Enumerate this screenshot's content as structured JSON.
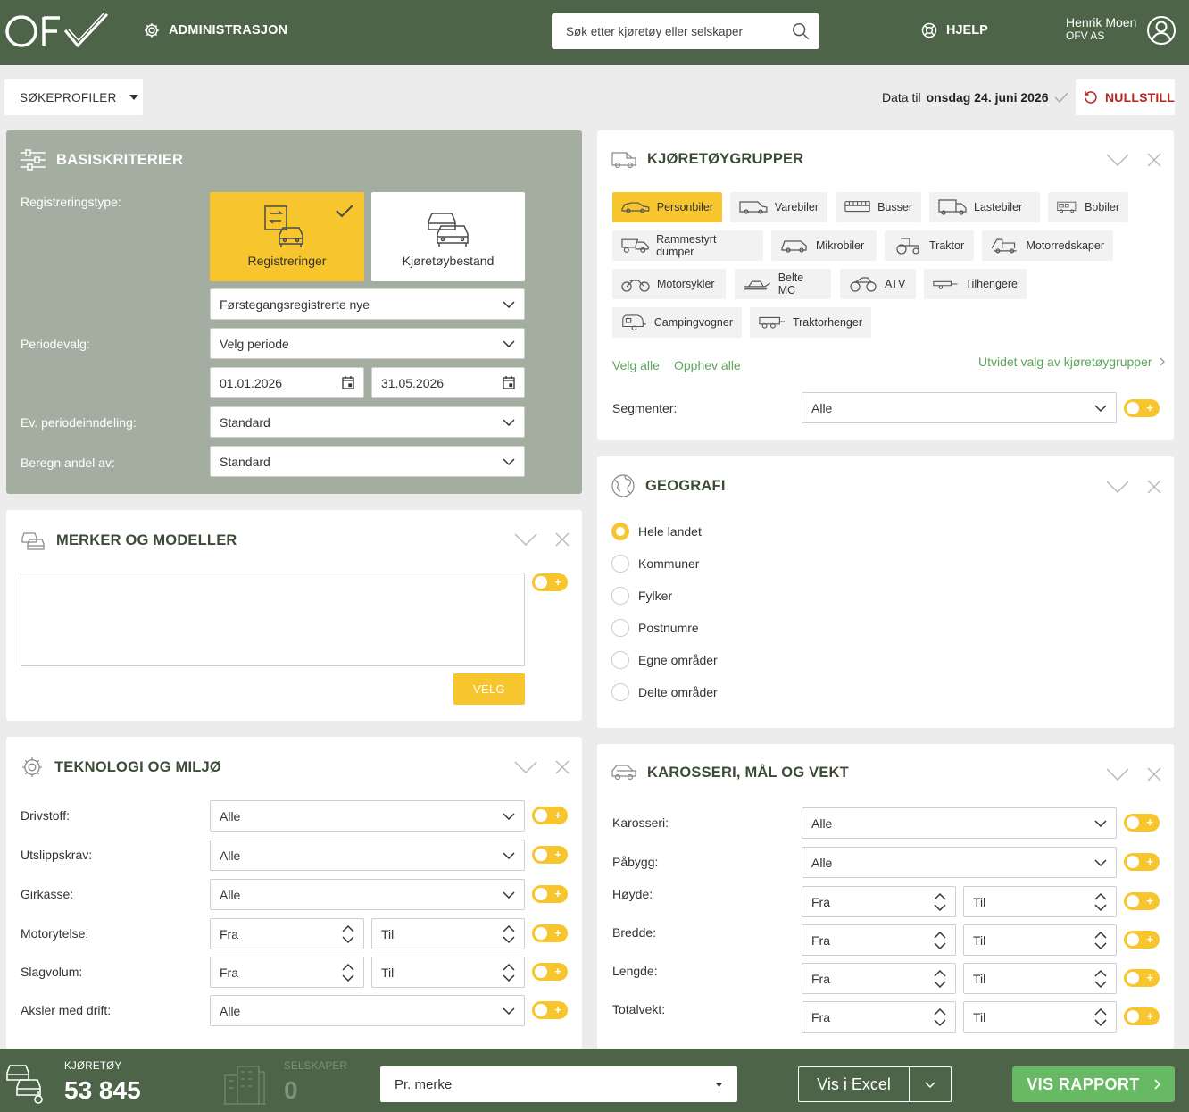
{
  "header": {
    "admin_label": "ADMINISTRASJON",
    "search_placeholder": "Søk etter kjøretøy eller selskaper",
    "help_label": "HJELP",
    "user_name": "Henrik Moen",
    "user_company": "OFV AS"
  },
  "toolbar": {
    "profiles_label": "SØKEPROFILER",
    "data_prefix": "Data til",
    "data_date": "onsdag 24. juni 2026",
    "reset_label": "NULLSTILL"
  },
  "basis": {
    "title": "BASISKRITERIER",
    "regtype_label": "Registreringstype:",
    "option_reg": "Registreringer",
    "option_stock": "Kjøretøybestand",
    "regtype_select": "Førstegangsregistrerte nye",
    "period_label": "Periodevalg:",
    "period_select": "Velg periode",
    "date_from": "01.01.2026",
    "date_to": "31.05.2026",
    "division_label": "Ev. periodeinndeling:",
    "division_select": "Standard",
    "share_label": "Beregn andel av:",
    "share_select": "Standard"
  },
  "brands": {
    "title": "MERKER OG MODELLER",
    "velg_label": "VELG"
  },
  "tech": {
    "title": "TEKNOLOGI OG MILJØ",
    "rows": [
      {
        "label": "Drivstoff:",
        "value": "Alle"
      },
      {
        "label": "Utslippskrav:",
        "value": "Alle"
      },
      {
        "label": "Girkasse:",
        "value": "Alle"
      }
    ],
    "range_rows": [
      {
        "label": "Motorytelse:",
        "from": "Fra",
        "to": "Til"
      },
      {
        "label": "Slagvolum:",
        "from": "Fra",
        "to": "Til"
      }
    ],
    "drive_label": "Aksler med drift:",
    "drive_value": "Alle"
  },
  "groups": {
    "title": "KJØRETØYGRUPPER",
    "chips": [
      "Personbiler",
      "Varebiler",
      "Busser",
      "Lastebiler",
      "Bobiler",
      "Rammestyrt dumper",
      "Mikrobiler",
      "Traktor",
      "Motorredskaper",
      "Motorsykler",
      "Belte MC",
      "ATV",
      "Tilhengere",
      "Campingvogner",
      "Traktorhenger"
    ],
    "select_all": "Velg alle",
    "deselect_all": "Opphev alle",
    "extended": "Utvidet valg av kjøretøygrupper",
    "segments_label": "Segmenter:",
    "segments_value": "Alle"
  },
  "geo": {
    "title": "GEOGRAFI",
    "options": [
      "Hele landet",
      "Kommuner",
      "Fylker",
      "Postnumre",
      "Egne områder",
      "Delte områder"
    ]
  },
  "body": {
    "title": "KAROSSERI, MÅL OG VEKT",
    "karosseri_label": "Karosseri:",
    "karosseri_value": "Alle",
    "pabygg_label": "Påbygg:",
    "pabygg_value": "Alle",
    "range_rows": [
      {
        "label": "Høyde:",
        "from": "Fra",
        "to": "Til"
      },
      {
        "label": "Bredde:",
        "from": "Fra",
        "to": "Til"
      },
      {
        "label": "Lengde:",
        "from": "Fra",
        "to": "Til"
      },
      {
        "label": "Totalvekt:",
        "from": "Fra",
        "to": "Til"
      }
    ]
  },
  "footer": {
    "vehicles_label": "KJØRETØY",
    "vehicles_count": "53 845",
    "companies_label": "SELSKAPER",
    "companies_count": "0",
    "group_select": "Pr. merke",
    "excel_label": "Vis i Excel",
    "report_label": "VIS RAPPORT"
  },
  "colors": {
    "green_dark": "#4d6448",
    "accent": "#f7c52d",
    "link_green": "#5da55a",
    "panel_grey": "#a3aea0"
  }
}
